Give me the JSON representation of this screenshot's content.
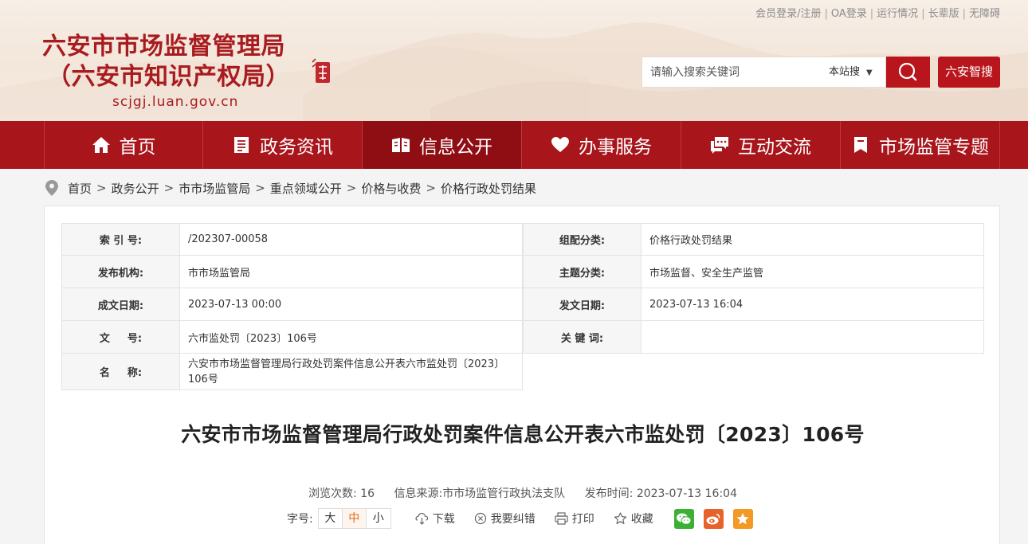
{
  "top_links": {
    "member": "会员登录/注册",
    "oa": "OA登录",
    "status": "运行情况",
    "elder": "长辈版",
    "accessible": "无障碍"
  },
  "site": {
    "title_line1": "六安市市场监督管理局",
    "title_line2": "（六安市知识产权局）",
    "domain": "scjgj.luan.gov.cn"
  },
  "search": {
    "placeholder": "请输入搜索关键词",
    "scope": "本站搜",
    "smart_label": "六安智搜"
  },
  "nav": {
    "items": [
      {
        "label": "首页",
        "icon": "home-icon"
      },
      {
        "label": "政务资讯",
        "icon": "document-icon"
      },
      {
        "label": "信息公开",
        "icon": "open-book-icon"
      },
      {
        "label": "办事服务",
        "icon": "heart-icon"
      },
      {
        "label": "互动交流",
        "icon": "chat-icon"
      },
      {
        "label": "市场监管专题",
        "icon": "bookmark-icon"
      }
    ],
    "active_index": 2
  },
  "breadcrumb": [
    "首页",
    "政务公开",
    "市市场监管局",
    "重点领域公开",
    "价格与收费",
    "价格行政处罚结果"
  ],
  "meta": {
    "index_no_label": "索 引 号:",
    "index_no": "/202307-00058",
    "category_label": "组配分类:",
    "category": "价格行政处罚结果",
    "publisher_label": "发布机构:",
    "publisher": "市市场监管局",
    "topic_label": "主题分类:",
    "topic": "市场监督、安全生产监管",
    "created_label": "成文日期:",
    "created": "2023-07-13 00:00",
    "published_label": "发文日期:",
    "published": "2023-07-13 16:04",
    "docno_label": "文 　 号:",
    "docno": "六市监处罚〔2023〕106号",
    "keywords_label": "关 键 词:",
    "keywords": "",
    "name_label": "名 　 称:",
    "name": "六安市市场监督管理局行政处罚案件信息公开表六市监处罚〔2023〕106号"
  },
  "doc": {
    "title": "六安市市场监督管理局行政处罚案件信息公开表六市监处罚〔2023〕106号",
    "views_label": "浏览次数:",
    "views": "16",
    "source_label": "信息来源:",
    "source": "市市场监管行政执法支队",
    "time_label": "发布时间:",
    "time": "2023-07-13 16:04"
  },
  "tools": {
    "fontsize_label": "字号:",
    "fs_large": "大",
    "fs_medium": "中",
    "fs_small": "小",
    "download": "下载",
    "correction": "我要纠错",
    "print": "打印",
    "favorite": "收藏"
  },
  "colors": {
    "brand_red": "#a8151b",
    "title_red": "#a81b1f",
    "active_orange": "#e06a14"
  }
}
